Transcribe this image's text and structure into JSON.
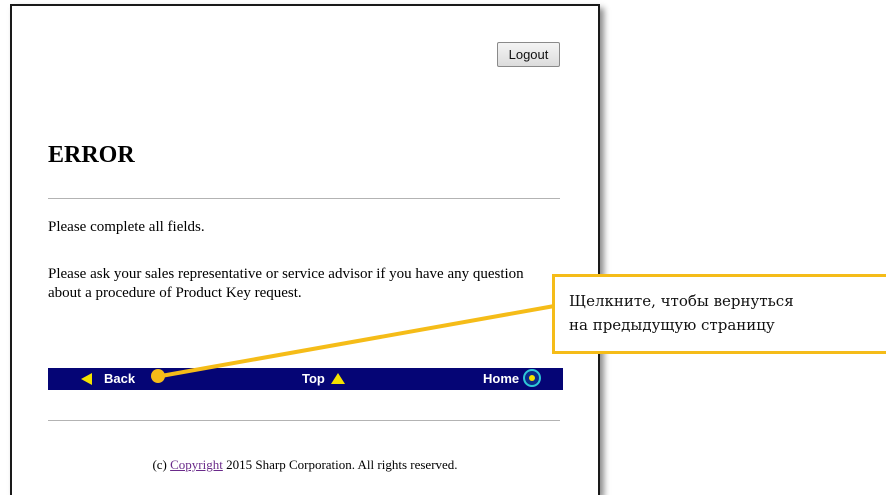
{
  "header": {
    "logout_label": "Logout"
  },
  "page": {
    "title": "ERROR",
    "message_1": "Please complete all fields.",
    "message_2": "Please ask your sales representative or service advisor if you have any question about a procedure of Product Key request."
  },
  "navbar": {
    "back_label": "Back",
    "top_label": "Top",
    "home_label": "Home",
    "back_icon": "left-triangle-icon",
    "top_icon": "up-triangle-icon",
    "home_icon": "home-circle-icon",
    "background_color": "#050575",
    "icon_color": "#f4e200"
  },
  "footer": {
    "prefix": "(c)",
    "link_label": "Copyright",
    "suffix": "2015 Sharp Corporation. All rights reserved."
  },
  "callout": {
    "text_line_1": "Щелкните, чтобы вернуться",
    "text_line_2": "на предыдущую страницу",
    "accent_color": "#f5bc18"
  }
}
